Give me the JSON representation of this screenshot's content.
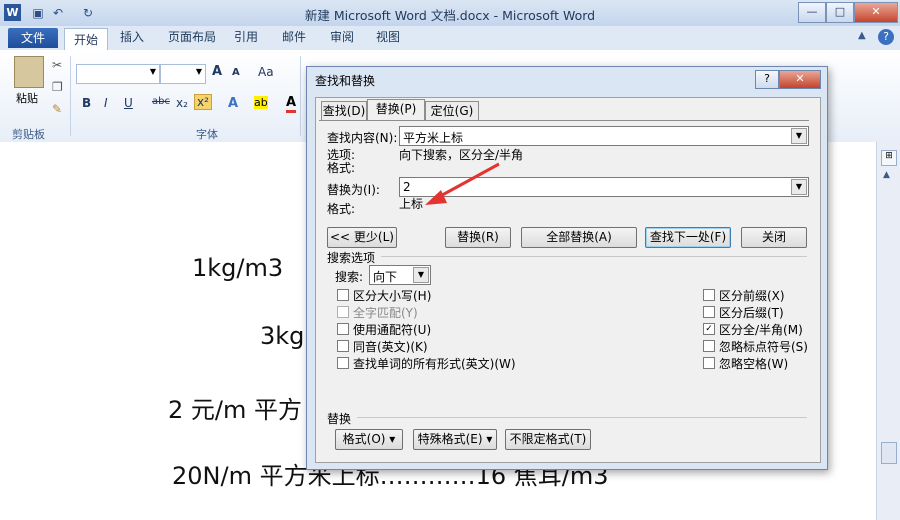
{
  "window": {
    "title": "新建 Microsoft Word 文档.docx - Microsoft Word",
    "logo_letter": "W",
    "min": "—",
    "max": "□",
    "close": "✕",
    "help": "?"
  },
  "ribbon": {
    "tabs": [
      "文件",
      "开始",
      "插入",
      "页面布局",
      "引用",
      "邮件",
      "审阅",
      "视图"
    ],
    "clipboard": {
      "paste_label": "粘贴",
      "group_label": "剪贴板"
    },
    "font": {
      "group_label": "字体",
      "name_value": "",
      "size_value": ""
    },
    "format_buttons": [
      "B",
      "I",
      "U",
      "abc",
      "x₂",
      "x²"
    ],
    "grow": "A",
    "shrink": "A",
    "case": "Aa"
  },
  "document": {
    "lines": [
      "1kg/m3",
      "3kg",
      "2 元/m 平方",
      "20N/m 平方米上标…………16 焦耳/m3"
    ]
  },
  "dialog": {
    "title": "查找和替换",
    "help": "?",
    "close": "✕",
    "tabs": [
      "查找(D)",
      "替换(P)",
      "定位(G)"
    ],
    "find_label": "查找内容(N):",
    "find_value": "平方米上标",
    "options_label": "选项:",
    "options_value": "向下搜索，区分全/半角",
    "format_label1": "格式:",
    "replace_label": "替换为(I):",
    "replace_value": "2",
    "format_label2": "格式:",
    "format_value2": "上标",
    "buttons": {
      "less": "<< 更少(L)",
      "replace": "替换(R)",
      "replace_all": "全部替换(A)",
      "find_next": "查找下一处(F)",
      "close": "关闭"
    },
    "search_options_label": "搜索选项",
    "search_label": "搜索:",
    "search_value": "向下",
    "left_options": [
      {
        "label": "区分大小写(H)",
        "checked": false,
        "disabled": false
      },
      {
        "label": "全字匹配(Y)",
        "checked": false,
        "disabled": true
      },
      {
        "label": "使用通配符(U)",
        "checked": false,
        "disabled": false
      },
      {
        "label": "同音(英文)(K)",
        "checked": false,
        "disabled": false
      },
      {
        "label": "查找单词的所有形式(英文)(W)",
        "checked": false,
        "disabled": false
      }
    ],
    "right_options": [
      {
        "label": "区分前缀(X)",
        "checked": false
      },
      {
        "label": "区分后缀(T)",
        "checked": false
      },
      {
        "label": "区分全/半角(M)",
        "checked": true
      },
      {
        "label": "忽略标点符号(S)",
        "checked": false
      },
      {
        "label": "忽略空格(W)",
        "checked": false
      }
    ],
    "replace_section_label": "替换",
    "bottom_buttons": {
      "format": "格式(O) ▾",
      "special": "特殊格式(E) ▾",
      "no_format": "不限定格式(T)"
    }
  },
  "colors": {
    "arrow": "#e3342f",
    "file_tab": "#2b579a"
  }
}
